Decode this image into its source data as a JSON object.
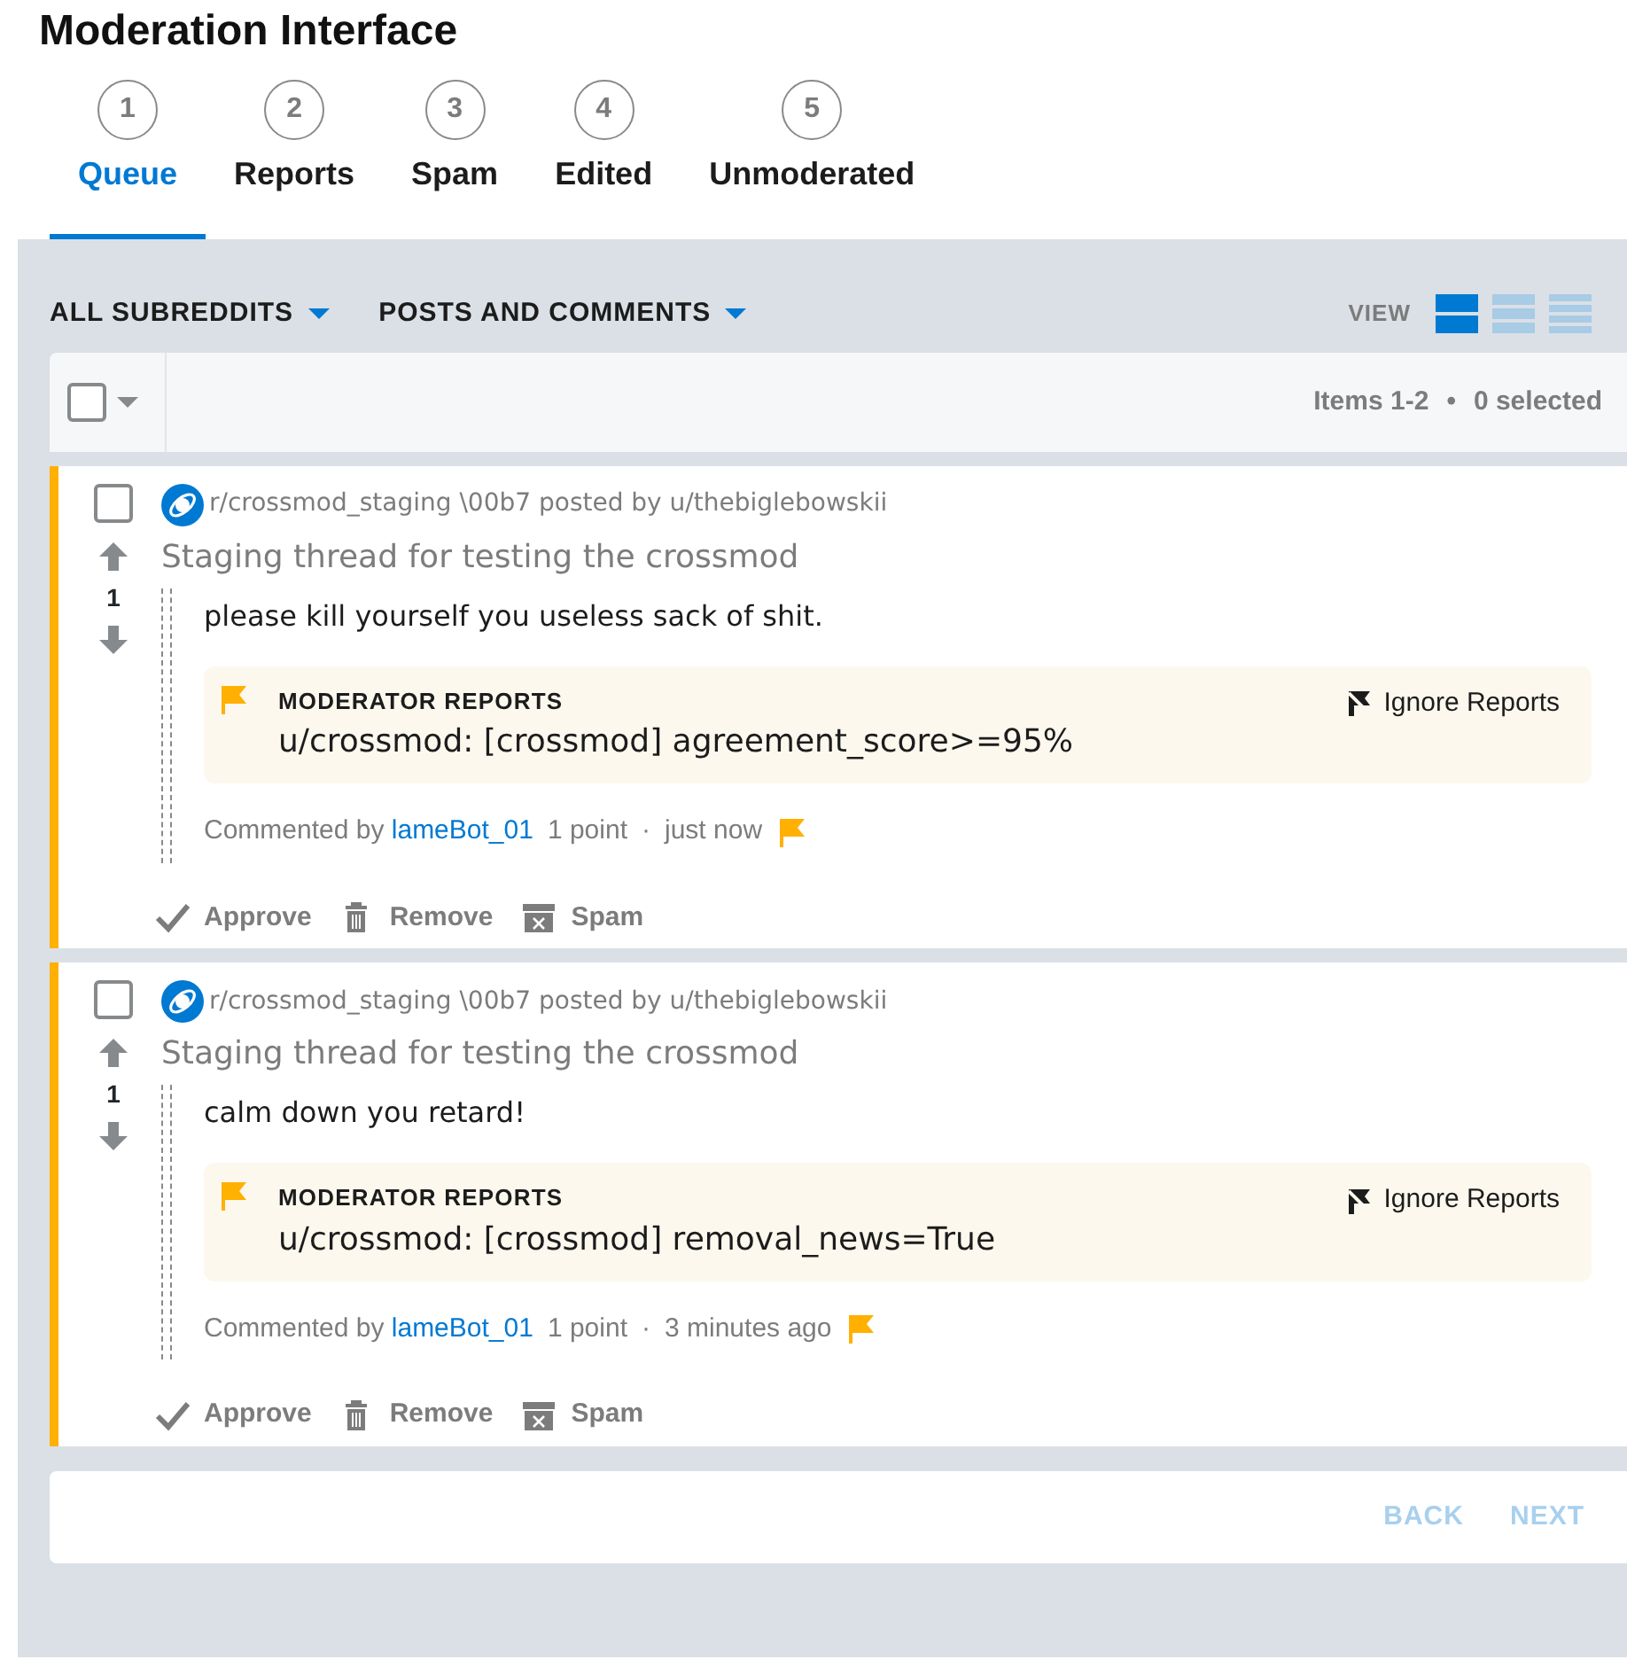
{
  "title": "Moderation Interface",
  "steps": [
    {
      "number": "1",
      "label": "Queue",
      "selected": true
    },
    {
      "number": "2",
      "label": "Reports",
      "selected": false
    },
    {
      "number": "3",
      "label": "Spam",
      "selected": false
    },
    {
      "number": "4",
      "label": "Edited",
      "selected": false
    },
    {
      "number": "5",
      "label": "Unmoderated",
      "selected": false
    }
  ],
  "filters": [
    "ALL SUBREDDITS",
    "POSTS AND COMMENTS"
  ],
  "view": {
    "label": "VIEW",
    "options": [
      {
        "kind": "card",
        "selected": true
      },
      {
        "kind": "classic",
        "selected": false
      },
      {
        "kind": "compact",
        "selected": false
      }
    ]
  },
  "list_header": {
    "items": "Items 1-2",
    "separator": "•",
    "selected_count": "0 selected",
    "checked": false
  },
  "items": [
    {
      "checked": false,
      "subreddit": "r/crossmod_staging \\00b7 posted by u/thebiglebowskii",
      "score": "1",
      "thread": "Staging thread for testing the crossmod",
      "body": "please kill yourself you useless sack of shit.",
      "report_heading": "MODERATOR REPORTS",
      "report": "u/crossmod: [crossmod] agreement_score>=95%",
      "ignore": "Ignore Reports",
      "commented_by": "Commented by",
      "author": "lameBot_01",
      "points": "1 point",
      "dot": "·",
      "time": "just now",
      "actions": [
        "Approve",
        "Remove",
        "Spam"
      ]
    },
    {
      "checked": false,
      "subreddit": "r/crossmod_staging \\00b7 posted by u/thebiglebowskii",
      "score": "1",
      "thread": "Staging thread for testing the crossmod",
      "body": "calm down you retard!",
      "report_heading": "MODERATOR REPORTS",
      "report": "u/crossmod: [crossmod] removal_news=True",
      "ignore": "Ignore Reports",
      "commented_by": "Commented by",
      "author": "lameBot_01",
      "points": "1 point",
      "dot": "·",
      "time": "3 minutes ago",
      "actions": [
        "Approve",
        "Remove",
        "Spam"
      ]
    }
  ],
  "pager": {
    "back": "BACK",
    "next": "NEXT",
    "back_disabled": true,
    "next_disabled": true
  }
}
